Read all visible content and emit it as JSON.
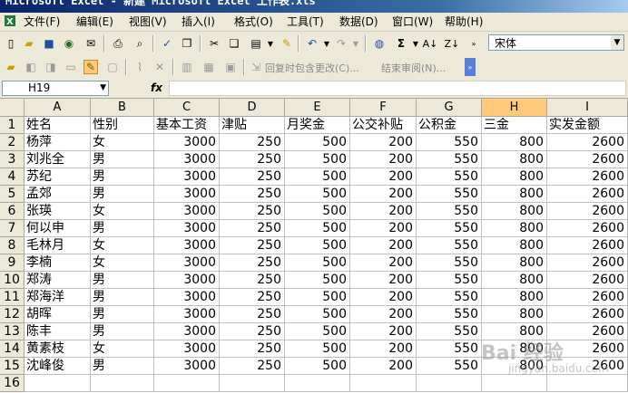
{
  "window": {
    "title": "Microsoft Excel - 新建 Microsoft Excel 工作表.xls"
  },
  "menu": [
    "文件(F)",
    "编辑(E)",
    "视图(V)",
    "插入(I)",
    "格式(O)",
    "工具(T)",
    "数据(D)",
    "窗口(W)",
    "帮助(H)"
  ],
  "toolbar": {
    "font_name": "宋体",
    "review_reply": "回复时包含更改(C)...",
    "review_end": "结束审阅(N)..."
  },
  "formula_bar": {
    "name_box": "H19",
    "fx_label": "fx",
    "formula": ""
  },
  "sheet": {
    "columns": [
      "A",
      "B",
      "C",
      "D",
      "E",
      "F",
      "G",
      "H",
      "I"
    ],
    "selected_column": "H",
    "row_numbers": [
      "1",
      "2",
      "3",
      "4",
      "5",
      "6",
      "7",
      "8",
      "9",
      "10",
      "11",
      "12",
      "13",
      "14",
      "15",
      "16"
    ],
    "headers": [
      "姓名",
      "性别",
      "基本工资",
      "津贴",
      "月奖金",
      "公交补贴",
      "公积金",
      "三金",
      "实发金额"
    ],
    "rows": [
      [
        "杨萍",
        "女",
        "3000",
        "250",
        "500",
        "200",
        "550",
        "800",
        "2600"
      ],
      [
        "刘兆全",
        "男",
        "3000",
        "250",
        "500",
        "200",
        "550",
        "800",
        "2600"
      ],
      [
        "苏纪",
        "男",
        "3000",
        "250",
        "500",
        "200",
        "550",
        "800",
        "2600"
      ],
      [
        "孟郊",
        "男",
        "3000",
        "250",
        "500",
        "200",
        "550",
        "800",
        "2600"
      ],
      [
        "张瑛",
        "女",
        "3000",
        "250",
        "500",
        "200",
        "550",
        "800",
        "2600"
      ],
      [
        "何以申",
        "男",
        "3000",
        "250",
        "500",
        "200",
        "550",
        "800",
        "2600"
      ],
      [
        "毛林月",
        "女",
        "3000",
        "250",
        "500",
        "200",
        "550",
        "800",
        "2600"
      ],
      [
        "李楠",
        "女",
        "3000",
        "250",
        "500",
        "200",
        "550",
        "800",
        "2600"
      ],
      [
        "郑涛",
        "男",
        "3000",
        "250",
        "500",
        "200",
        "550",
        "800",
        "2600"
      ],
      [
        "郑海洋",
        "男",
        "3000",
        "250",
        "500",
        "200",
        "550",
        "800",
        "2600"
      ],
      [
        "胡晖",
        "男",
        "3000",
        "250",
        "500",
        "200",
        "550",
        "800",
        "2600"
      ],
      [
        "陈丰",
        "男",
        "3000",
        "250",
        "500",
        "200",
        "550",
        "800",
        "2600"
      ],
      [
        "黄素枝",
        "女",
        "3000",
        "250",
        "500",
        "200",
        "550",
        "800",
        "2600"
      ],
      [
        "沈峰俊",
        "男",
        "3000",
        "250",
        "500",
        "200",
        "550",
        "800",
        "2600"
      ]
    ]
  },
  "watermark": {
    "main": "Bai 经验",
    "sub": "jingyan.baidu.com"
  },
  "colors": {
    "title_bar": "#0a246a",
    "chrome": "#ece9d8",
    "selected_header": "#ffc97a",
    "gridline": "#c0c0c0"
  }
}
